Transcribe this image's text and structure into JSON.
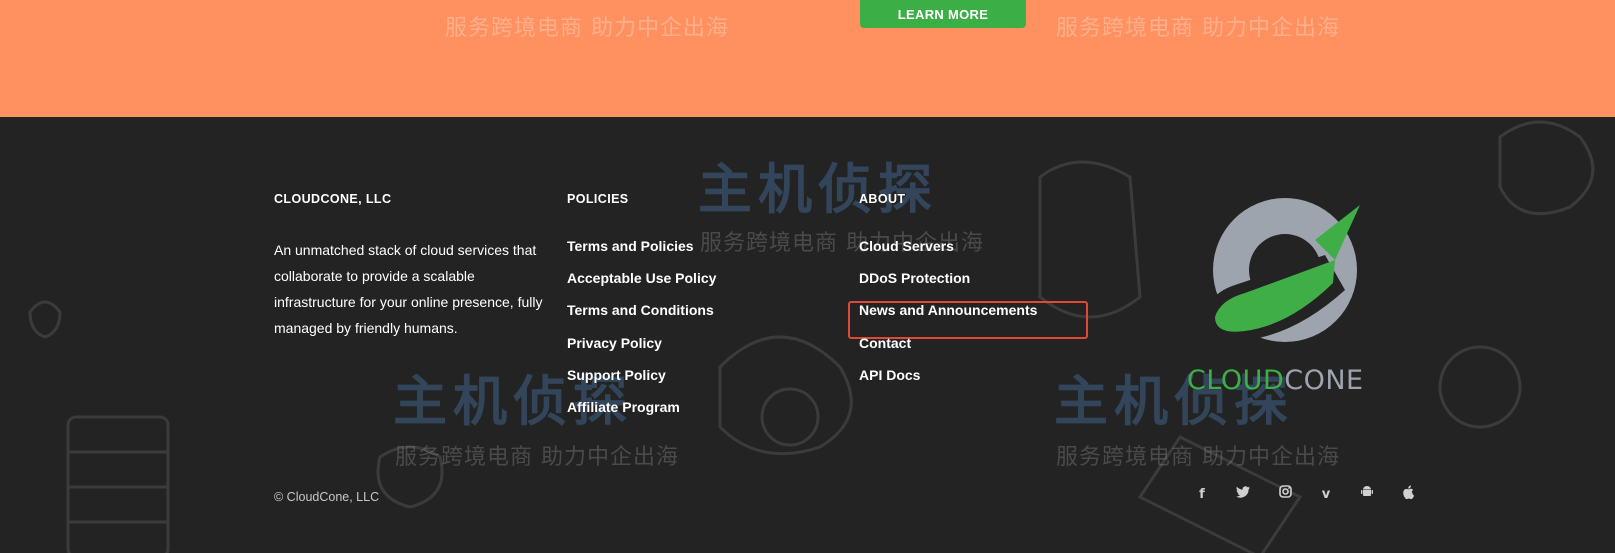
{
  "hero": {
    "button_label": "LEARN MORE",
    "watermark_slogan_1": "服务跨境电商  助力中企出海",
    "watermark_slogan_2": "服务跨境电商  助力中企出海"
  },
  "watermark": {
    "title": "主机侦探",
    "slogan": "服务跨境电商  助力中企出海"
  },
  "footer": {
    "company": {
      "title": "CLOUDCONE, LLC",
      "description": "An unmatched stack of cloud services that collaborate to provide a scalable infrastructure for your online presence, fully managed by friendly humans."
    },
    "policies": {
      "title": "POLICIES",
      "links": [
        "Terms and Policies",
        "Acceptable Use Policy",
        "Terms and Conditions",
        "Privacy Policy",
        "Support Policy",
        "Affiliate Program"
      ]
    },
    "about": {
      "title": "ABOUT",
      "links": [
        "Cloud Servers",
        "DDoS Protection",
        "News and Announcements",
        "Contact",
        "API Docs"
      ],
      "highlighted": "News and Announcements"
    },
    "logo": {
      "part1": "CLOUD",
      "part2": "CONE"
    },
    "copyright": "© CloudCone, LLC",
    "social_icons": [
      "facebook-icon",
      "twitter-icon",
      "instagram-icon",
      "vimeo-icon",
      "android-icon",
      "apple-icon"
    ]
  },
  "colors": {
    "top_band": "#ff9060",
    "footer_bg": "#222322",
    "brand_green": "#3fae46",
    "brand_gray": "#9ea4ad",
    "highlight": "#e0483a"
  }
}
